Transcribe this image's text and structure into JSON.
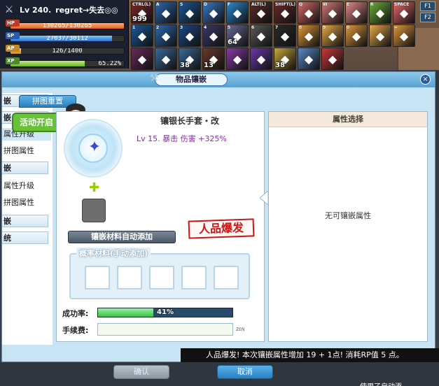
{
  "hud": {
    "level": "Lv 240.",
    "name": "regret→失去◎◎",
    "hp_label": "HP",
    "hp_value": "130265/130265",
    "hp_ratio": 1.0,
    "sp_label": "SP",
    "sp_value": "27037/30112",
    "sp_ratio": 0.898,
    "ap_label": "AP",
    "ap_value": "126/1400",
    "ap_ratio": 0.09,
    "xp_label": "XP",
    "xp_value": "65.22%",
    "xp_ratio": 0.6522
  },
  "skills": {
    "row1": [
      {
        "key": "CTRL(L)",
        "count": "999",
        "color": "#7a2a2a"
      },
      {
        "key": "A",
        "count": "",
        "color": "#2a6ab0"
      },
      {
        "key": "S",
        "count": "",
        "color": "#1a5a9a"
      },
      {
        "key": "D",
        "count": "",
        "color": "#3a7ac8"
      },
      {
        "key": "F",
        "count": "",
        "color": "#2a8ad0"
      },
      {
        "key": "ALT(L)",
        "count": "",
        "color": "#5a2a2a"
      },
      {
        "key": "SHIFT(L)",
        "count": "",
        "color": "#6a2a2a"
      },
      {
        "key": "Q",
        "count": "",
        "color": "#d86a6a"
      },
      {
        "key": "W",
        "count": "",
        "color": "#d87a7a"
      },
      {
        "key": "E",
        "count": "",
        "color": "#e48a8a"
      },
      {
        "key": "R",
        "count": "",
        "color": "#6ab03a"
      },
      {
        "key": "SPACE",
        "count": "",
        "color": "#e86a6a"
      }
    ],
    "row2": [
      {
        "key": "1",
        "count": "",
        "color": "#1a5a9a"
      },
      {
        "key": "2",
        "count": "",
        "color": "#2a6ab0"
      },
      {
        "key": "3",
        "count": "",
        "color": "#1a4a8a"
      },
      {
        "key": "4",
        "count": "",
        "color": "#3a3a6a"
      },
      {
        "key": "5",
        "count": "64",
        "color": "#6a6a9a"
      },
      {
        "key": "6",
        "count": "",
        "color": "#5a5a5a"
      },
      {
        "key": "7",
        "count": "",
        "color": "#2a2a2a"
      },
      {
        "key": "8",
        "count": "",
        "color": "#e09a3a"
      },
      {
        "key": "9",
        "count": "",
        "color": "#e8aa4a"
      },
      {
        "key": "0",
        "count": "",
        "color": "#e09a3a"
      },
      {
        "key": "-",
        "count": "",
        "color": "#e8aa4a"
      },
      {
        "key": "=",
        "count": "",
        "color": "#e09a3a"
      }
    ],
    "row3": [
      {
        "key": "",
        "count": "",
        "color": "#6a2a5a"
      },
      {
        "key": "",
        "count": "",
        "color": "#3a6a9a"
      },
      {
        "key": "",
        "count": "38",
        "color": "#3a6a9a"
      },
      {
        "key": "",
        "count": "13",
        "color": "#6a3a2a"
      },
      {
        "key": "",
        "count": "",
        "color": "#8a3aa8"
      },
      {
        "key": "",
        "count": "",
        "color": "#6a3aa8"
      },
      {
        "key": "",
        "count": "38",
        "color": "#c8a83a"
      },
      {
        "key": "",
        "count": "",
        "color": "#5a8ac8"
      },
      {
        "key": "",
        "count": "",
        "color": "#c83a3a"
      }
    ],
    "fkeys": [
      "F1",
      "F2"
    ]
  },
  "window": {
    "title": "物品镶嵌",
    "close": "×",
    "tab_reset": "拼图重置",
    "event": "活动开启"
  },
  "side_menu": [
    {
      "label": "嵌",
      "type": "hdr"
    },
    {
      "label": "嵌",
      "type": "hdr"
    },
    {
      "label": "属性升级",
      "type": "sel"
    },
    {
      "label": "拼图属性",
      "type": "item"
    },
    {
      "label": "嵌",
      "type": "hdr"
    },
    {
      "label": "属性升级",
      "type": "item"
    },
    {
      "label": "拼图属性",
      "type": "item"
    },
    {
      "label": "嵌",
      "type": "hdr"
    },
    {
      "label": "统",
      "type": "hdr"
    }
  ],
  "panel_mid": {
    "item_name": "镶银长手套・改",
    "item_stat": "Lv 15. 暴击 伤害 +325%",
    "auto_add": "镶嵌材料自动添加",
    "stamp": "人品爆发",
    "prob_label": "概率材料(手动添加)",
    "success_label": "成功率:",
    "success_rate": "41%",
    "success_ratio": 0.41,
    "fee_label": "手续费:",
    "fee_value": "",
    "zeny": "ZEN"
  },
  "panel_right": {
    "header": "属性选择",
    "empty": "无可镶嵌属性"
  },
  "broadcast": "人品爆发! 本次镶嵌属性增加 19 + 1点!   消耗RP值 5 点。",
  "buttons": {
    "ok": "确认",
    "cancel": "取消"
  },
  "footer_tip": "使用了自动添"
}
